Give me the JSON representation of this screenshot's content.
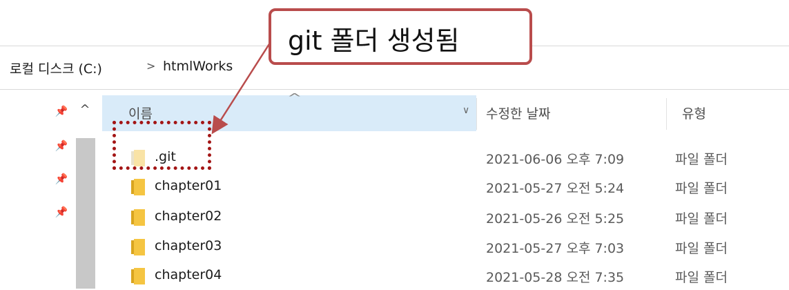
{
  "breadcrumb": {
    "drive": "로컬 디스크 (C:)",
    "separator": ">",
    "folder": "htmlWorks"
  },
  "columns": {
    "name": "이름",
    "modified": "수정한 날짜",
    "type": "유형"
  },
  "rows": [
    {
      "name": ".git",
      "modified": "2021-06-06 오후 7:09",
      "type": "파일 폴더",
      "hidden": true
    },
    {
      "name": "chapter01",
      "modified": "2021-05-27 오전 5:24",
      "type": "파일 폴더"
    },
    {
      "name": "chapter02",
      "modified": "2021-05-26 오전 5:25",
      "type": "파일 폴더"
    },
    {
      "name": "chapter03",
      "modified": "2021-05-27 오후 7:03",
      "type": "파일 폴더"
    },
    {
      "name": "chapter04",
      "modified": "2021-05-28 오전 7:35",
      "type": "파일 폴더"
    }
  ],
  "annotation": {
    "text": "git 폴더 생성됨",
    "color": "#b94c4c"
  },
  "colors": {
    "header_selected": "#d9ebf9",
    "folder": "#f5c542",
    "folder_hidden": "#f9e3a6"
  },
  "icons": [
    "pin-icon",
    "scroll-up-icon",
    "sort-ascending-icon",
    "chevron-down-icon",
    "folder-icon"
  ]
}
